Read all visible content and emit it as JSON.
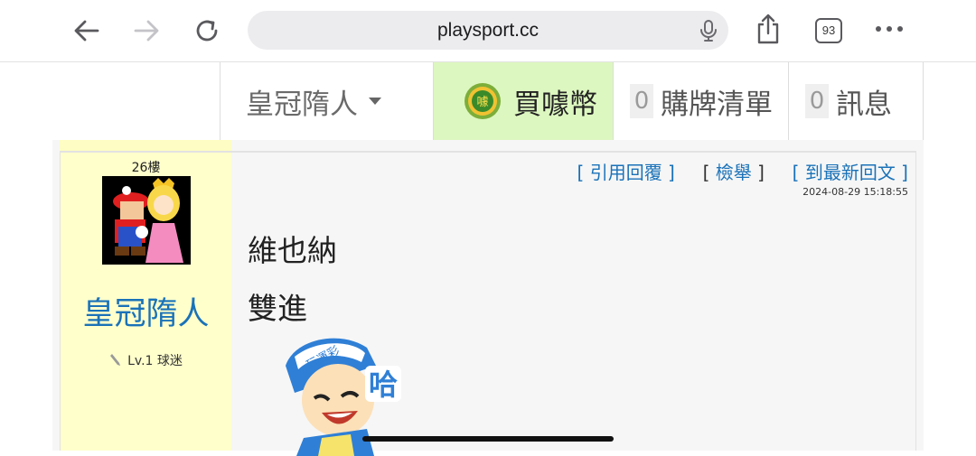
{
  "browser": {
    "url": "playsport.cc",
    "tab_count": "93",
    "icons": [
      "back-arrow-icon",
      "forward-arrow-icon",
      "reload-icon",
      "microphone-icon",
      "share-icon",
      "tabs-icon",
      "more-icon"
    ]
  },
  "site_nav": {
    "user_menu_label": "皇冠隋人",
    "buy_coin_label": "買噱幣",
    "coin_badge_text": "噱",
    "cart_count": "0",
    "cart_label": "購牌清單",
    "messages_count": "0",
    "messages_label": "訊息"
  },
  "post": {
    "floor": "26樓",
    "username": "皇冠隋人",
    "level": "Lv.1 球迷",
    "actions": {
      "quote": "引用回覆",
      "report": "檢舉",
      "latest": "到最新回文"
    },
    "timestamp": "2024-08-29 15:18:55",
    "lines": [
      "維也納",
      "雙進"
    ],
    "sticker_text": "哈",
    "sticker_side_text": "玩運彩"
  },
  "colors": {
    "link_blue": "#1a72b8",
    "user_column_bg": "#ffffcc",
    "buy_coin_bg": "#ddf7c0"
  }
}
